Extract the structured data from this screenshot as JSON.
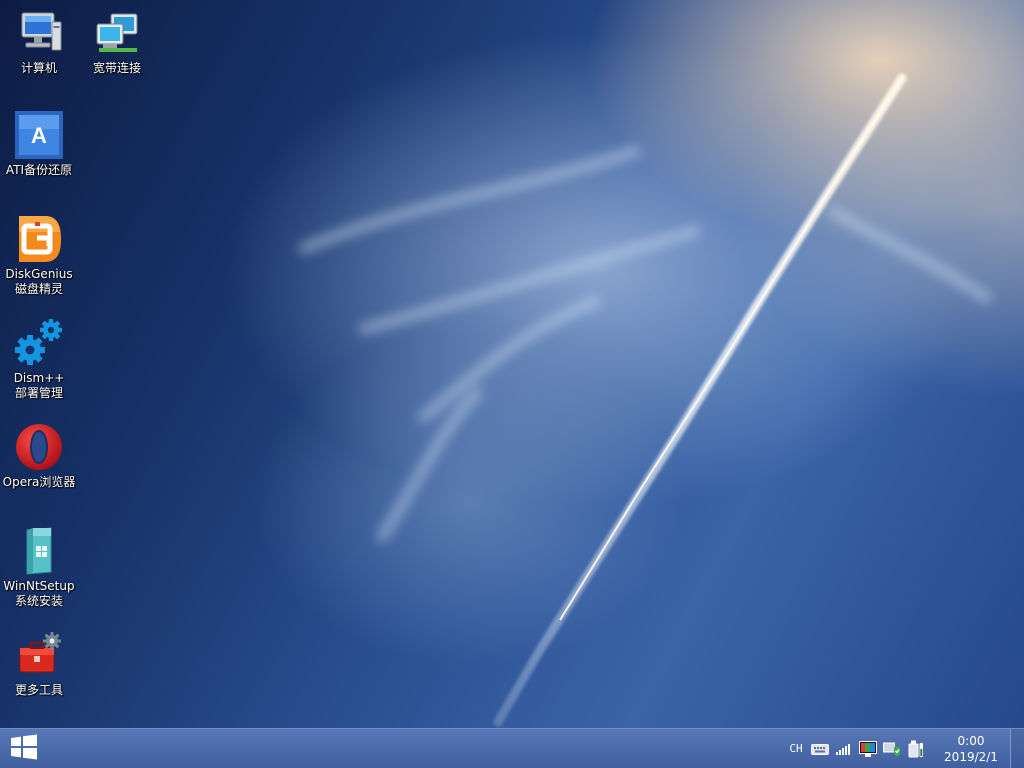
{
  "desktop": {
    "icons": [
      {
        "name": "computer-icon",
        "label_lines": [
          "计算机"
        ]
      },
      {
        "name": "broadband-connection-icon",
        "label_lines": [
          "宽带连接"
        ]
      },
      {
        "name": "ati-backup-icon",
        "label_lines": [
          "ATI备份还原"
        ]
      },
      {
        "name": "diskgenius-icon",
        "label_lines": [
          "DiskGenius",
          "磁盘精灵"
        ]
      },
      {
        "name": "dism-gear-icon",
        "label_lines": [
          "Dism++",
          "部署管理"
        ]
      },
      {
        "name": "opera-icon",
        "label_lines": [
          "Opera浏览器"
        ]
      },
      {
        "name": "winntsetup-icon",
        "label_lines": [
          "WinNtSetup",
          "系统安装"
        ]
      },
      {
        "name": "toolbox-icon",
        "label_lines": [
          "更多工具"
        ]
      }
    ]
  },
  "taskbar": {
    "start_icon": "windows-logo-icon",
    "tray": {
      "language": "CH",
      "icons": [
        "keyboard-icon",
        "signal-bars-icon",
        "display-color-icon",
        "security-shield-icon",
        "usb-device-icon"
      ]
    },
    "clock": {
      "time": "0:00",
      "date": "2019/2/1"
    }
  }
}
